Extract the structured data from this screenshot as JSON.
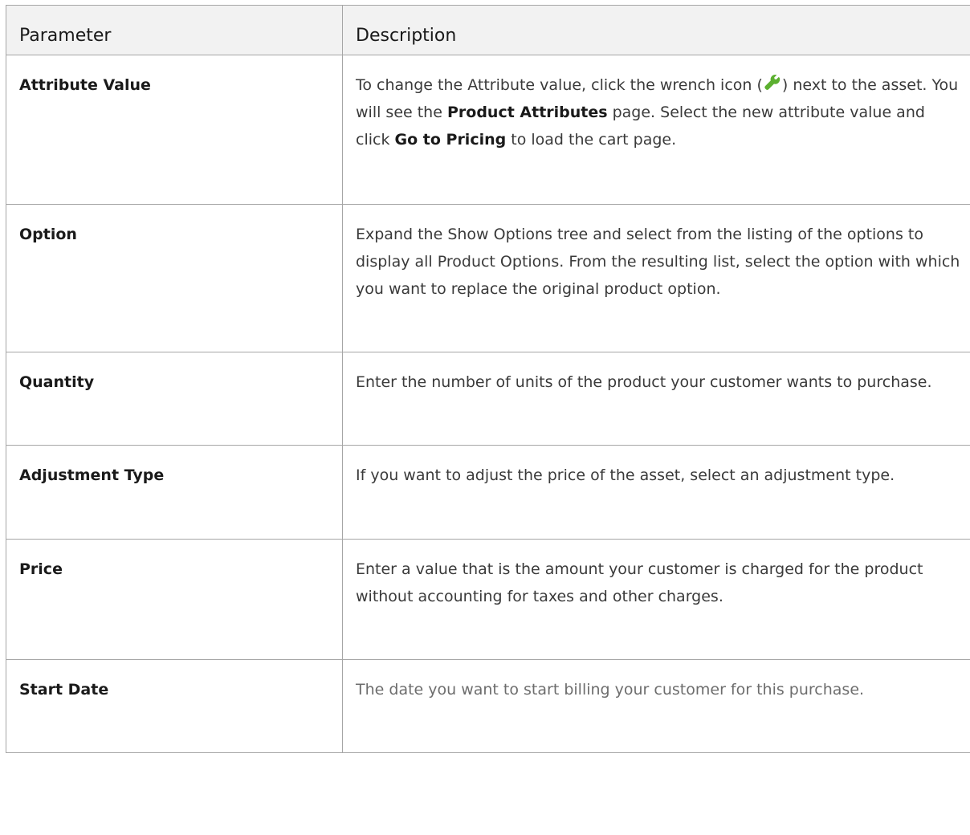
{
  "table": {
    "headers": {
      "parameter": "Parameter",
      "description": "Description"
    },
    "rows": [
      {
        "name": "Attribute Value",
        "desc": {
          "p1": "To change the Attribute value, click the wrench icon (",
          "p2": ") next to the asset. You will see the ",
          "b1": "Product Attributes",
          "p3": " page. Select the new attribute value and click ",
          "b2": "Go to Pricing",
          "p4": " to load the cart page."
        }
      },
      {
        "name": "Option",
        "desc": "Expand the Show Options tree and select from the listing of the options to display all Product Options. From the resulting list, select the option with which you want to replace the original product option."
      },
      {
        "name": "Quantity",
        "desc": "Enter the number of units of the product your customer wants to purchase."
      },
      {
        "name": "Adjustment Type",
        "desc": "If you want to adjust the price of the asset, select an adjustment type."
      },
      {
        "name": "Price",
        "desc": "Enter a value that is the amount your customer is charged for the product without accounting for taxes and other charges."
      },
      {
        "name": "Start Date",
        "desc": "The date you want to start billing your customer for this purchase."
      }
    ]
  },
  "icons": {
    "wrench": "wrench-icon",
    "wrench_color": "#5cb030"
  }
}
